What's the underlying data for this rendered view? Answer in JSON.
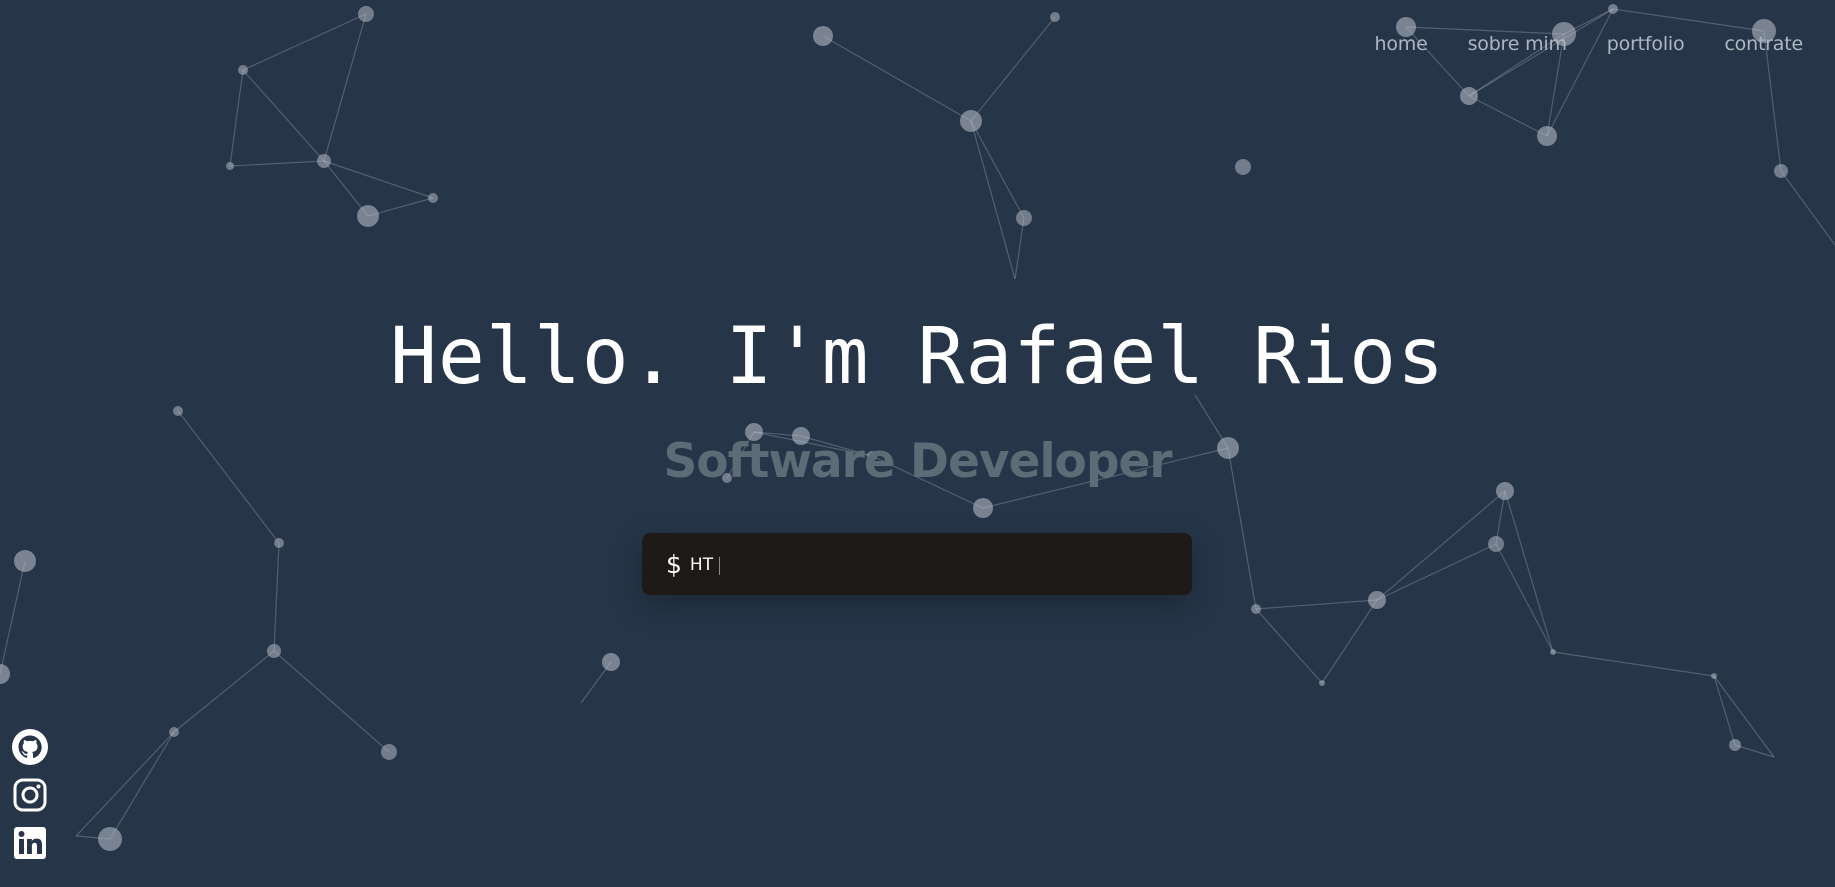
{
  "nav": {
    "items": [
      {
        "label": "home"
      },
      {
        "label": "sobre mim"
      },
      {
        "label": "portfolio"
      },
      {
        "label": "contrate"
      }
    ]
  },
  "hero": {
    "title": "Hello. I'm Rafael Rios",
    "subtitle": "Software Developer"
  },
  "terminal": {
    "prompt": "$",
    "typed_text": "HT"
  },
  "social": [
    {
      "icon": "github-icon"
    },
    {
      "icon": "instagram-icon"
    },
    {
      "icon": "linkedin-icon"
    }
  ],
  "colors": {
    "background": "#263548",
    "terminal": "#1d1a18",
    "subtitle": "#5c6c76",
    "nav": "#aeb6c2"
  }
}
